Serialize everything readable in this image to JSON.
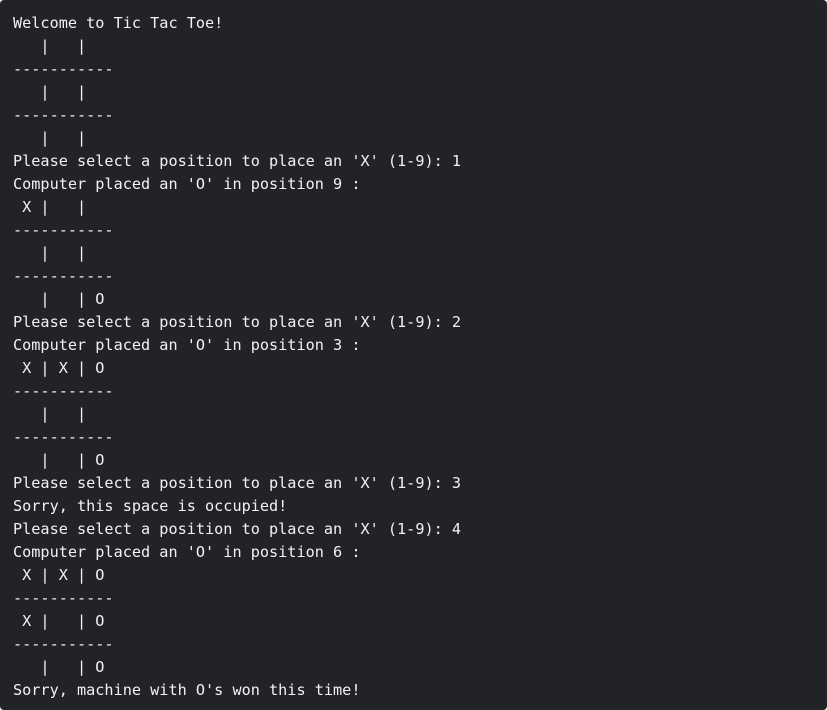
{
  "terminal": {
    "background": "#212327",
    "text_color": "#f2f2f2",
    "lines": [
      "Welcome to Tic Tac Toe!",
      "   |   |",
      "-----------",
      "   |   |",
      "-----------",
      "   |   |",
      "Please select a position to place an 'X' (1-9): 1",
      "Computer placed an 'O' in position 9 :",
      " X |   |",
      "-----------",
      "   |   |",
      "-----------",
      "   |   | O",
      "Please select a position to place an 'X' (1-9): 2",
      "Computer placed an 'O' in position 3 :",
      " X | X | O",
      "-----------",
      "   |   |",
      "-----------",
      "   |   | O",
      "Please select a position to place an 'X' (1-9): 3",
      "Sorry, this space is occupied!",
      "Please select a position to place an 'X' (1-9): 4",
      "Computer placed an 'O' in position 6 :",
      " X | X | O",
      "-----------",
      " X |   | O",
      "-----------",
      "   |   | O",
      "Sorry, machine with O's won this time!"
    ]
  }
}
